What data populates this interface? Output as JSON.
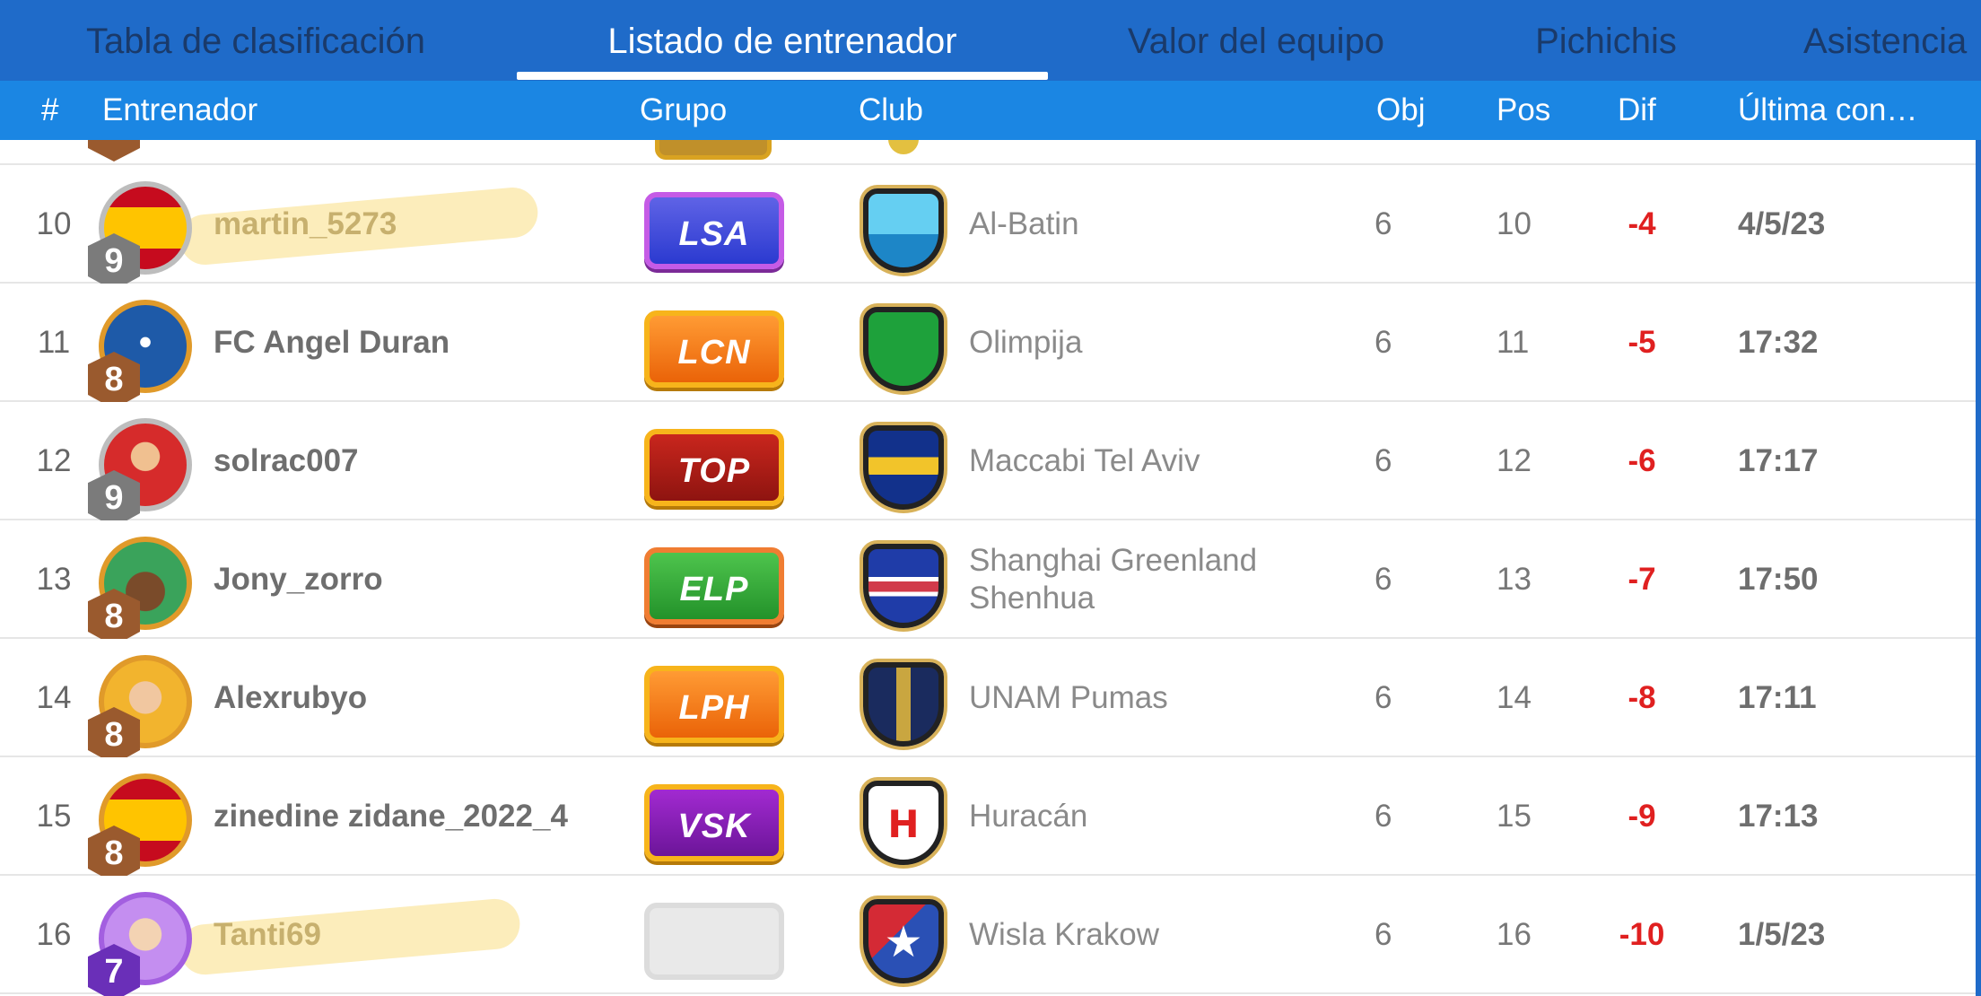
{
  "tabs": [
    {
      "label": "Tabla de clasificación",
      "active": false
    },
    {
      "label": "Listado de entrenador",
      "active": true
    },
    {
      "label": "Valor del equipo",
      "active": false
    },
    {
      "label": "Pichichis",
      "active": false
    },
    {
      "label": "Asistencia",
      "active": false
    }
  ],
  "columns": {
    "rank": "#",
    "coach": "Entrenador",
    "group": "Grupo",
    "club": "Club",
    "obj": "Obj",
    "pos": "Pos",
    "dif": "Dif",
    "last": "Última con…"
  },
  "rows": [
    {
      "rank": "10",
      "level": "9",
      "coach": "martin_5273",
      "group": "LSA",
      "club": "Al-Batin",
      "obj": "6",
      "pos": "10",
      "dif": "-4",
      "last": "4/5/23"
    },
    {
      "rank": "11",
      "level": "8",
      "coach": "FC Angel Duran",
      "group": "LCN",
      "club": "Olimpija",
      "obj": "6",
      "pos": "11",
      "dif": "-5",
      "last": "17:32"
    },
    {
      "rank": "12",
      "level": "9",
      "coach": "solrac007",
      "group": "TOP",
      "club": "Maccabi Tel Aviv",
      "obj": "6",
      "pos": "12",
      "dif": "-6",
      "last": "17:17"
    },
    {
      "rank": "13",
      "level": "8",
      "coach": "Jony_zorro",
      "group": "ELP",
      "club": "Shanghai Greenland Shenhua",
      "obj": "6",
      "pos": "13",
      "dif": "-7",
      "last": "17:50"
    },
    {
      "rank": "14",
      "level": "8",
      "coach": "Alexrubyo",
      "group": "LPH",
      "club": "UNAM Pumas",
      "obj": "6",
      "pos": "14",
      "dif": "-8",
      "last": "17:11"
    },
    {
      "rank": "15",
      "level": "8",
      "coach": "zinedine zidane_2022_4",
      "group": "VSK",
      "club": "Huracán",
      "obj": "6",
      "pos": "15",
      "dif": "-9",
      "last": "17:13"
    },
    {
      "rank": "16",
      "level": "7",
      "coach": "Tanti69",
      "group": "",
      "club": "Wisla Krakow",
      "obj": "6",
      "pos": "16",
      "dif": "-10",
      "last": "1/5/23"
    }
  ],
  "crest_letters": {
    "huracan": "H",
    "wisla": "★"
  },
  "colors": {
    "tab_bar": "#1f6bc9",
    "header_bar": "#1b86e3",
    "negative_diff": "#e02020",
    "highlight": "#fadc78"
  }
}
